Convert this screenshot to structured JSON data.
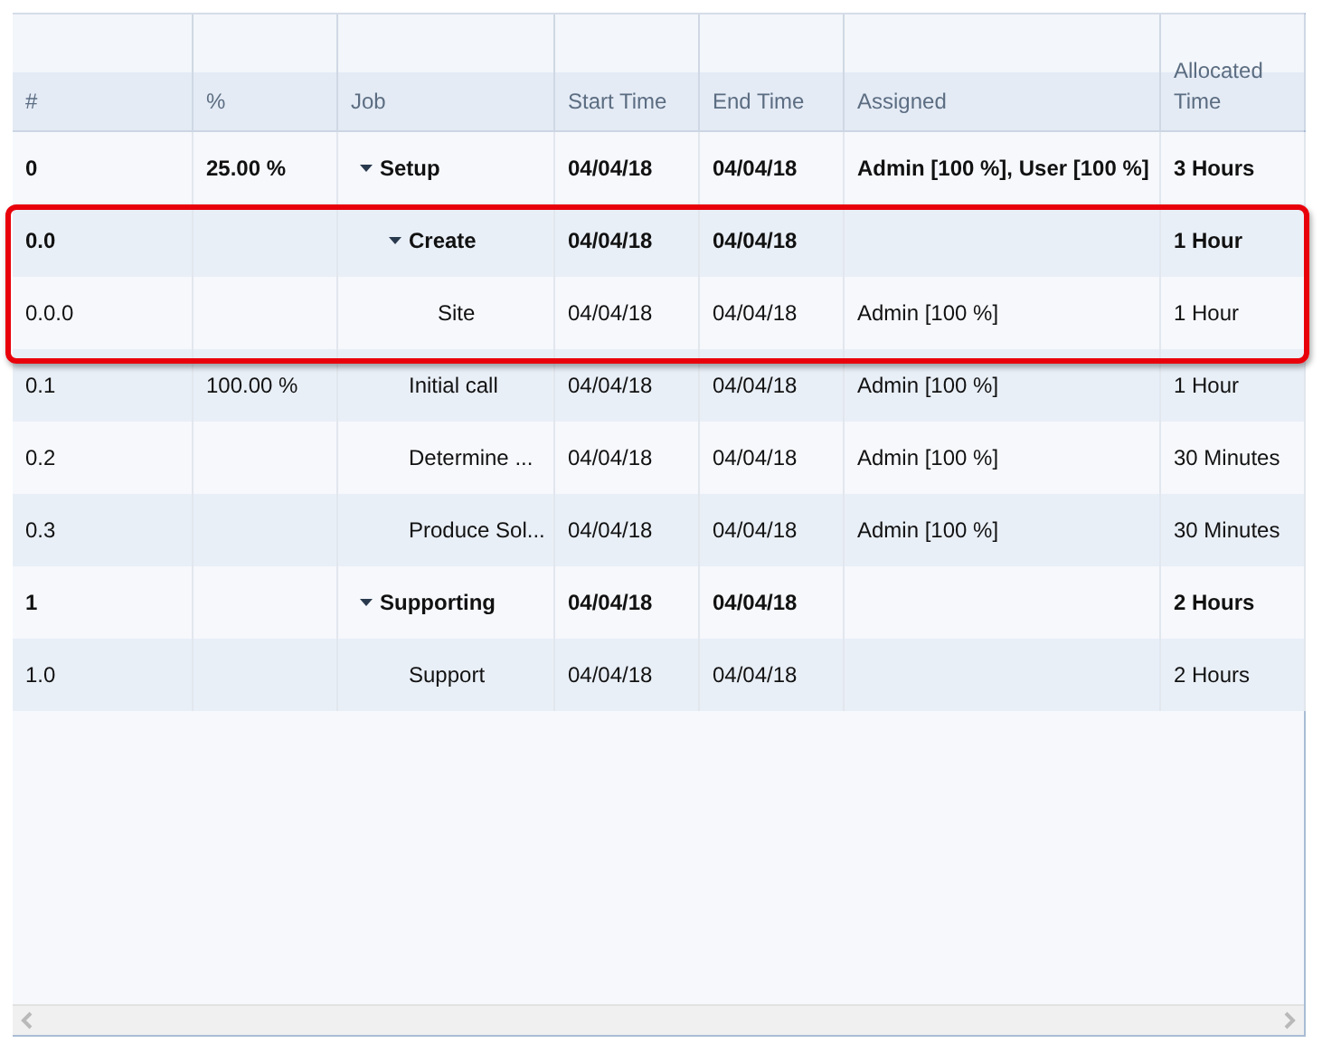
{
  "table": {
    "columns": [
      "#",
      "%",
      "Job",
      "Start Time",
      "End Time",
      "Assigned",
      "Allocated Time"
    ],
    "rows": [
      {
        "number": "0",
        "percent": "25.00 %",
        "job": "Setup",
        "start": "04/04/18",
        "end": "04/04/18",
        "assigned": "Admin [100 %], User [100 %]",
        "allocated": "3 Hours",
        "kind": "summary",
        "expanded": true,
        "highlighted": false,
        "children": [
          {
            "number": "0.0",
            "job": "Create",
            "start": "04/04/18",
            "end": "04/04/18",
            "allocated": "1 Hour",
            "kind": "summary",
            "expanded": true,
            "highlighted": true,
            "children": [
              {
                "number": "0.0.0",
                "job": "Site",
                "start": "04/04/18",
                "end": "04/04/18",
                "assigned": "Admin [100 %]",
                "allocated": "1 Hour",
                "kind": "task",
                "highlighted": true
              }
            ]
          },
          {
            "number": "0.1",
            "percent": "100.00 %",
            "job": "Initial call",
            "start": "04/04/18",
            "end": "04/04/18",
            "assigned": "Admin [100 %]",
            "allocated": "1 Hour",
            "kind": "task",
            "highlighted": false
          },
          {
            "number": "0.2",
            "job": "Determine ...",
            "start": "04/04/18",
            "end": "04/04/18",
            "assigned": "Admin [100 %]",
            "allocated": "30 Minutes",
            "kind": "task",
            "highlighted": false
          },
          {
            "number": "0.3",
            "job": "Produce Sol...",
            "start": "04/04/18",
            "end": "04/04/18",
            "assigned": "Admin [100 %]",
            "allocated": "30 Minutes",
            "kind": "task",
            "highlighted": false
          }
        ]
      },
      {
        "number": "1",
        "job": "Supporting",
        "start": "04/04/18",
        "end": "04/04/18",
        "allocated": "2 Hours",
        "kind": "summary",
        "expanded": true,
        "highlighted": false,
        "children": [
          {
            "number": "1.0",
            "job": "Support",
            "start": "04/04/18",
            "end": "04/04/18",
            "allocated": "2 Hours",
            "kind": "task",
            "highlighted": false
          }
        ]
      }
    ]
  }
}
